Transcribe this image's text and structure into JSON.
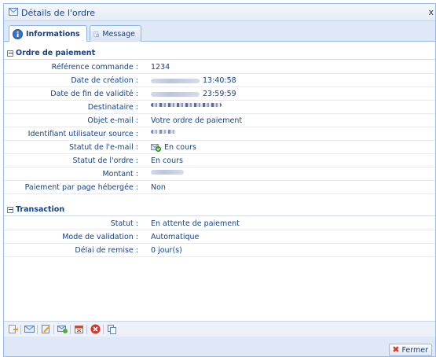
{
  "window": {
    "title": "Détails de l'ordre",
    "close_glyph": "x"
  },
  "tabs": [
    {
      "label": "Informations",
      "icon": "info-icon",
      "active": true
    },
    {
      "label": "Message",
      "icon": "message-icon",
      "active": false
    }
  ],
  "sections": {
    "ordre": {
      "title": "Ordre de paiement",
      "toggle": "⊟",
      "rows": [
        {
          "label": "Référence commande :",
          "value": "1234"
        },
        {
          "label": "Date de création :",
          "value": "13:40:58"
        },
        {
          "label": "Date de fin de validité :",
          "value": "23:59:59"
        },
        {
          "label": "Destinataire :",
          "value": ""
        },
        {
          "label": "Objet e-mail :",
          "value": "Votre ordre de paiement"
        },
        {
          "label": "Identifiant utilisateur source :",
          "value": ""
        },
        {
          "label": "Statut de l'e-mail :",
          "value": "En cours"
        },
        {
          "label": "Statut de l'ordre :",
          "value": "En cours"
        },
        {
          "label": "Montant :",
          "value": ""
        },
        {
          "label": "Paiement par page hébergée :",
          "value": "Non"
        }
      ]
    },
    "transaction": {
      "title": "Transaction",
      "toggle": "⊟",
      "rows": [
        {
          "label": "Statut :",
          "value": "En attente de paiement"
        },
        {
          "label": "Mode de validation :",
          "value": "Automatique"
        },
        {
          "label": "Délai de remise :",
          "value": "0 jour(s)"
        }
      ]
    }
  },
  "footer": {
    "close_label": "Fermer"
  },
  "colors": {
    "accent": "#15428b",
    "border": "#99bbe8",
    "panel_bg": "#dfe8f6"
  }
}
